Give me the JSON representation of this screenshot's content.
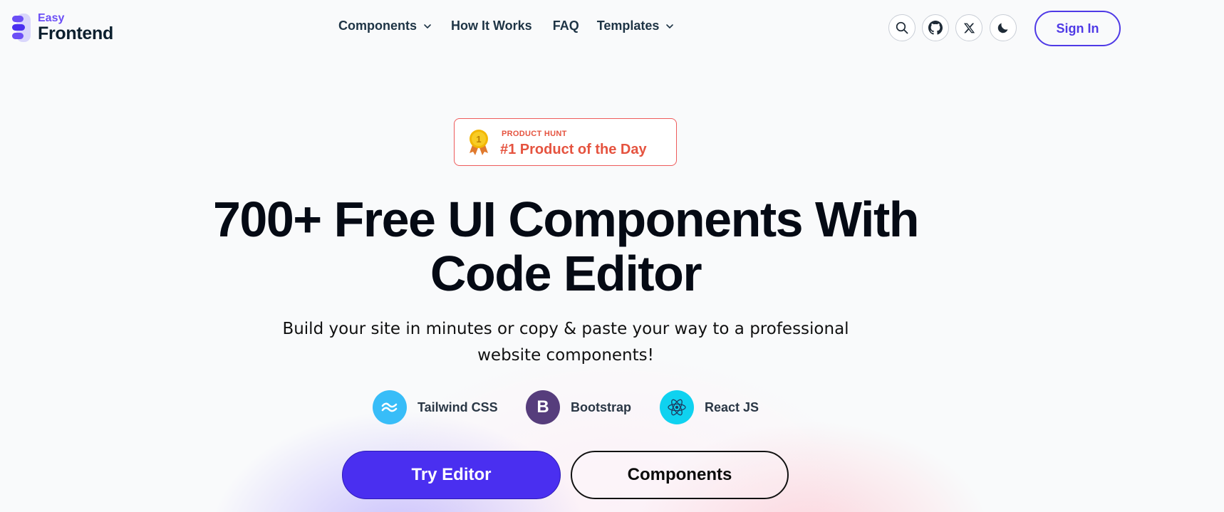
{
  "brand": {
    "small": "Easy",
    "big": "Frontend",
    "accent_color": "#6b4ef6"
  },
  "nav": {
    "items": [
      {
        "label": "Components",
        "has_dropdown": true
      },
      {
        "label": "How It Works",
        "has_dropdown": false
      },
      {
        "label": "FAQ",
        "has_dropdown": false
      },
      {
        "label": "Templates",
        "has_dropdown": true
      }
    ]
  },
  "toolbar": {
    "icons": [
      "search-icon",
      "github-icon",
      "x-icon",
      "moon-icon"
    ],
    "signin_label": "Sign In"
  },
  "badge": {
    "small": "PRODUCT HUNT",
    "big": "#1 Product of the Day",
    "medal_number": "1",
    "color": "#e5533f"
  },
  "hero": {
    "title_line1": "700+ Free UI Components With",
    "title_line2": "Code Editor",
    "subtitle_line1": "Build your site in minutes or copy & paste your way to a professional",
    "subtitle_line2": "website components!"
  },
  "tech": [
    {
      "label": "Tailwind CSS",
      "icon": "tailwind-icon",
      "color": "#38bdf8"
    },
    {
      "label": "Bootstrap",
      "icon": "bootstrap-icon",
      "glyph": "B",
      "color": "#563d7c"
    },
    {
      "label": "React JS",
      "icon": "react-icon",
      "color": "#0fd2f0"
    }
  ],
  "cta": {
    "primary_label": "Try Editor",
    "secondary_label": "Components",
    "primary_color": "#4a2ff0"
  }
}
